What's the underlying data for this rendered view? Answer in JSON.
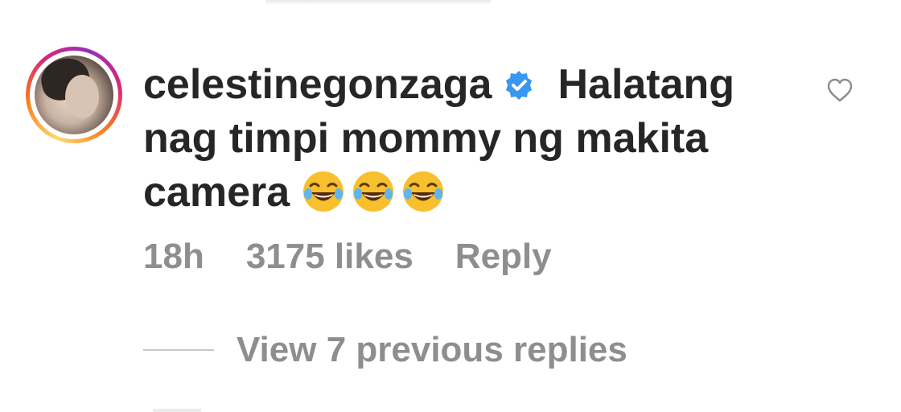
{
  "comment": {
    "username": "celestinegonzaga",
    "verified": true,
    "text": "Halatang nag timpi mommy ng makita camera",
    "emoji_count": 3,
    "emoji_name": "face-with-tears-of-joy",
    "time": "18h",
    "likes": "3175 likes",
    "reply_label": "Reply",
    "view_replies": "View 7 previous replies"
  },
  "colors": {
    "text": "#262626",
    "meta": "#8e8e8e",
    "verified_blue": "#3897f0",
    "line": "#c7c7c7"
  },
  "icons": {
    "verified": "verified-badge-icon",
    "like": "heart-outline-icon",
    "emoji": "face-with-tears-of-joy-icon"
  }
}
